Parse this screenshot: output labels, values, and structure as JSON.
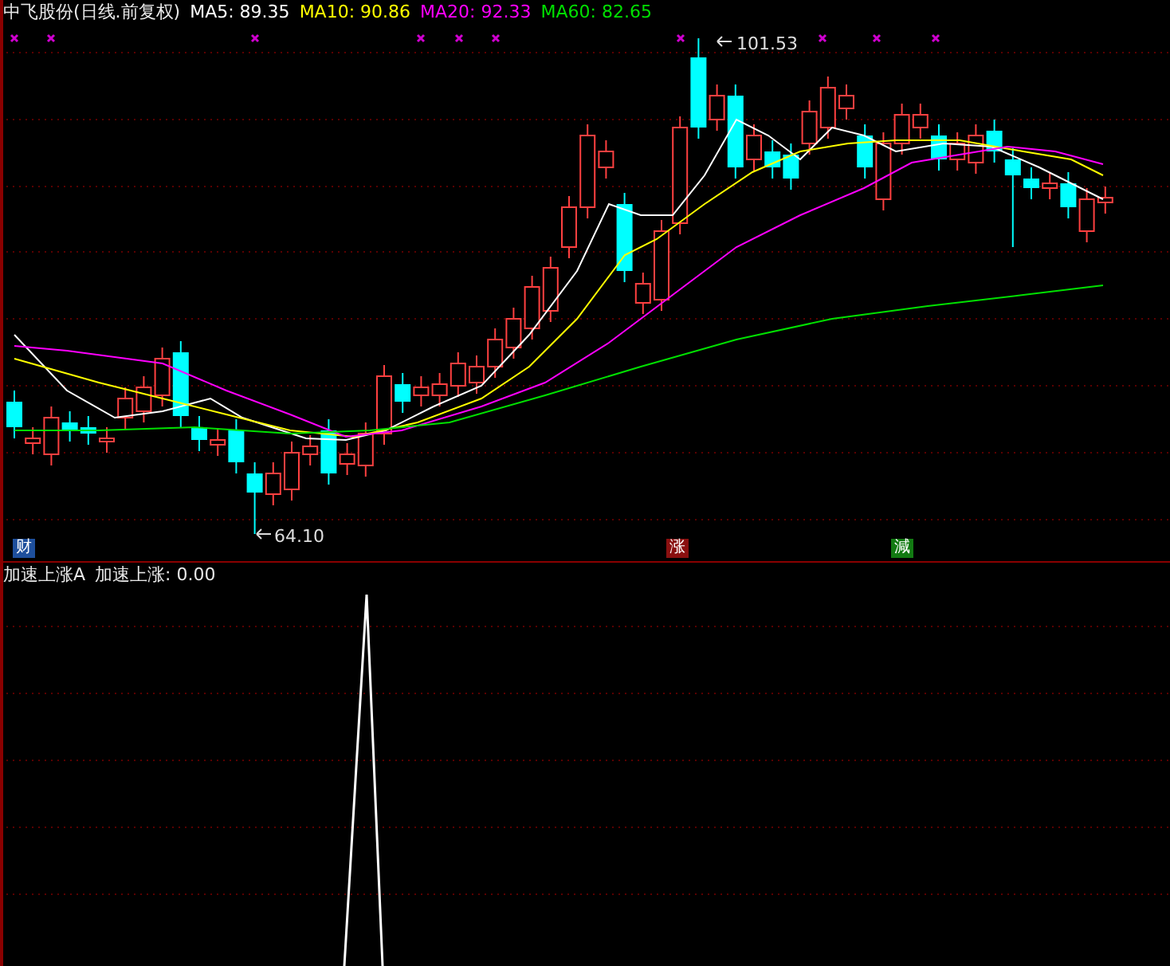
{
  "price_panel": {
    "title": "中飞股份(日线.前复权)",
    "moving_averages": [
      {
        "label": "MA5: 89.35",
        "color": "#ffffff"
      },
      {
        "label": "MA10: 90.86",
        "color": "#ffff00"
      },
      {
        "label": "MA20: 92.33",
        "color": "#ff00ff"
      },
      {
        "label": "MA60: 82.65",
        "color": "#00e000"
      }
    ],
    "high_label": "101.53",
    "low_label": "64.10",
    "event_tags": [
      {
        "label": "财",
        "color": "#1e4f9c"
      },
      {
        "label": "涨",
        "color": "#8a1010"
      },
      {
        "label": "減",
        "color": "#127a12"
      }
    ]
  },
  "indicator_panel": {
    "title": "加速上涨A",
    "reading": "加速上涨: 0.00"
  }
}
